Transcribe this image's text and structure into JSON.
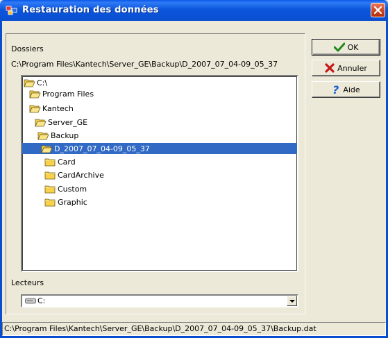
{
  "window": {
    "title": "Restauration des données"
  },
  "labels": {
    "folders": "Dossiers",
    "current_path": "C:\\Program Files\\Kantech\\Server_GE\\Backup\\D_2007_07_04-09_05_37",
    "drives": "Lecteurs"
  },
  "tree": {
    "items": [
      {
        "label": "C:\\",
        "icon": "open-folder-icon",
        "selected": false
      },
      {
        "label": "Program Files",
        "icon": "open-folder-icon",
        "selected": false
      },
      {
        "label": "Kantech",
        "icon": "open-folder-icon",
        "selected": false
      },
      {
        "label": "Server_GE",
        "icon": "open-folder-icon",
        "selected": false
      },
      {
        "label": "Backup",
        "icon": "open-folder-icon",
        "selected": false
      },
      {
        "label": "D_2007_07_04-09_05_37",
        "icon": "open-folder-icon",
        "selected": true
      },
      {
        "label": "Card",
        "icon": "folder-icon",
        "selected": false
      },
      {
        "label": "CardArchive",
        "icon": "folder-icon",
        "selected": false
      },
      {
        "label": "Custom",
        "icon": "folder-icon",
        "selected": false
      },
      {
        "label": "Graphic",
        "icon": "folder-icon",
        "selected": false
      }
    ]
  },
  "drive_select": {
    "value": "C:",
    "icon": "drive-icon"
  },
  "buttons": {
    "ok": "OK",
    "cancel": "Annuler",
    "help": "Aide"
  },
  "status": {
    "text": "C:\\Program Files\\Kantech\\Server_GE\\Backup\\D_2007_07_04-09_05_37\\Backup.dat"
  },
  "colors": {
    "title_bar": "#0a4ed0",
    "selection": "#316ac5",
    "dialog_bg": "#ece9d8",
    "folder_yellow": "#f7d24a"
  }
}
